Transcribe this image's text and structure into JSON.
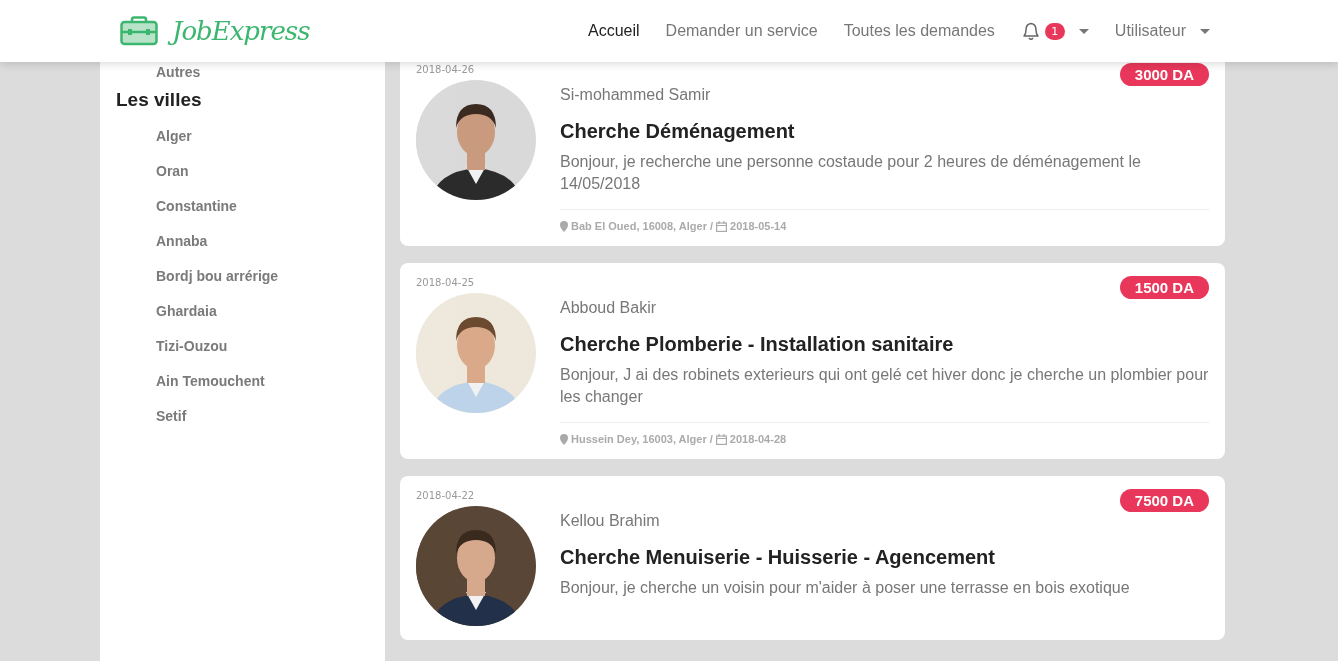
{
  "header": {
    "logo": "JobExpress",
    "nav": [
      {
        "label": "Accueil",
        "selected": true
      },
      {
        "label": "Demander un service",
        "selected": false
      },
      {
        "label": "Toutes les demandes",
        "selected": false
      }
    ],
    "notifications": {
      "count": "1"
    },
    "user_menu": "Utilisateur"
  },
  "sidebar": {
    "items_above": [
      "Autres"
    ],
    "heading": "Les villes",
    "cities": [
      "Alger",
      "Oran",
      "Constantine",
      "Annaba",
      "Bordj bou arrérige",
      "Ghardaia",
      "Tizi-Ouzou",
      "Ain Temouchent",
      "Setif"
    ]
  },
  "requests": [
    {
      "date": "2018-04-26",
      "price": "3000 DA",
      "name": "Si-mohammed Samir",
      "title": "Cherche Déménagement",
      "description": "Bonjour, je recherche une personne costaude pour 2 heures de déménagement le 14/05/2018",
      "location": "Bab El Oued, 16008, Alger /",
      "due_date": "2018-05-14"
    },
    {
      "date": "2018-04-25",
      "price": "1500 DA",
      "name": "Abboud Bakir",
      "title": "Cherche Plomberie - Installation sanitaire",
      "description": "Bonjour, J ai des robinets exterieurs qui ont gelé cet hiver donc je cherche un plombier pour les changer",
      "location": "Hussein Dey, 16003, Alger /",
      "due_date": "2018-04-28"
    },
    {
      "date": "2018-04-22",
      "price": "7500 DA",
      "name": "Kellou Brahim",
      "title": "Cherche Menuiserie - Huisserie - Agencement",
      "description": "Bonjour, je cherche un voisin pour m'aider à poser une terrasse en bois exotique"
    }
  ]
}
